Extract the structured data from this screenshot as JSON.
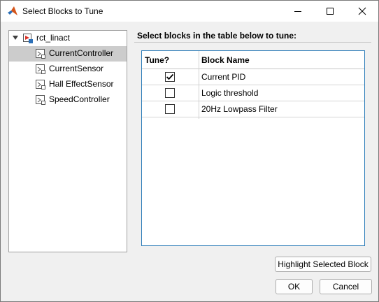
{
  "window": {
    "title": "Select Blocks to Tune",
    "app_icon": "matlab-icon",
    "minimize_icon": "minimize-icon",
    "maximize_icon": "maximize-icon",
    "close_icon": "close-icon"
  },
  "tree": {
    "root": {
      "label": "rct_linact",
      "icon": "simulink-model-icon",
      "expanded": true
    },
    "items": [
      {
        "label": "CurrentController",
        "icon": "subsystem-block-icon",
        "selected": true
      },
      {
        "label": "CurrentSensor",
        "icon": "subsystem-block-icon",
        "selected": false
      },
      {
        "label": "Hall EffectSensor",
        "icon": "subsystem-block-icon",
        "selected": false
      },
      {
        "label": "SpeedController",
        "icon": "subsystem-block-icon",
        "selected": false
      }
    ]
  },
  "section": {
    "title": "Select blocks in the table below to tune:"
  },
  "table": {
    "headers": [
      "Tune?",
      "Block Name"
    ],
    "rows": [
      {
        "tune": true,
        "block_name": "Current PID"
      },
      {
        "tune": false,
        "block_name": "Logic threshold"
      },
      {
        "tune": false,
        "block_name": "20Hz Lowpass Filter"
      }
    ]
  },
  "buttons": {
    "highlight": "Highlight Selected Block",
    "ok": "OK",
    "cancel": "Cancel"
  },
  "colors": {
    "selection": "#cccccc",
    "table_border": "#2e7db9",
    "dialog_background": "#f0f0f0"
  }
}
